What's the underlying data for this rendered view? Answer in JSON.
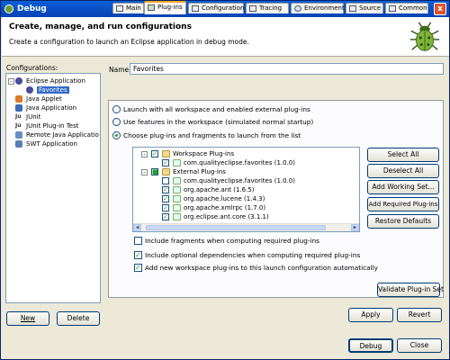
{
  "window": {
    "title": "Debug",
    "close_glyph": "x"
  },
  "header": {
    "title": "Create, manage, and run configurations",
    "subtitle": "Create a configuration to launch an Eclipse application in debug mode."
  },
  "configurations": {
    "label": "Configurations:",
    "items": [
      {
        "label": "Eclipse Application",
        "icon": "eclipse-icon",
        "expanded": true
      },
      {
        "label": "Favorites",
        "icon": "eclipse-config-icon",
        "selected": true
      },
      {
        "label": "Java Applet",
        "icon": "java-applet-icon"
      },
      {
        "label": "Java Application",
        "icon": "java-app-icon"
      },
      {
        "label": "JUnit",
        "icon": "junit-icon"
      },
      {
        "label": "JUnit Plug-in Test",
        "icon": "junit-plugin-icon"
      },
      {
        "label": "Remote Java Applicatio",
        "icon": "remote-java-icon"
      },
      {
        "label": "SWT Application",
        "icon": "swt-icon"
      }
    ],
    "new_label": "New",
    "delete_label": "Delete"
  },
  "name_label": "Name:",
  "name_value": "Favorites",
  "tabs": [
    {
      "label": "Main",
      "icon": "main-tab-icon"
    },
    {
      "label": "Plug-ins",
      "icon": "plugins-tab-icon",
      "active": true
    },
    {
      "label": "Configuration",
      "icon": "config-tab-icon"
    },
    {
      "label": "Tracing",
      "icon": "tracing-tab-icon"
    },
    {
      "label": "Environment",
      "icon": "environment-tab-icon"
    },
    {
      "label": "Source",
      "icon": "source-tab-icon"
    },
    {
      "label": "Common",
      "icon": "common-tab-icon"
    }
  ],
  "launch_options": [
    {
      "label": "Launch with all workspace and enabled external plug-ins",
      "selected": false
    },
    {
      "label": "Use features in the workspace (simulated normal startup)",
      "selected": false
    },
    {
      "label": "Choose plug-ins and fragments to launch from the list",
      "selected": true
    }
  ],
  "plugin_tree": [
    {
      "label": "Workspace Plug-ins",
      "level": 0,
      "checked": true,
      "expander": "-",
      "folder": true
    },
    {
      "label": "com.qualityeclipse.favorites (1.0.0)",
      "level": 1,
      "checked": true
    },
    {
      "label": "External Plug-ins",
      "level": 0,
      "checked": true,
      "partial": true,
      "expander": "-",
      "folder": true
    },
    {
      "label": "com.qualityeclipse.favorites (1.0.0)",
      "level": 1,
      "checked": false
    },
    {
      "label": "org.apache.ant (1.6.5)",
      "level": 1,
      "checked": true
    },
    {
      "label": "org.apache.lucene (1.4.3)",
      "level": 1,
      "checked": true
    },
    {
      "label": "org.apache.xmlrpc (1.7.0)",
      "level": 1,
      "checked": true
    },
    {
      "label": "org.eclipse.ant.core (3.1.1)",
      "level": 1,
      "checked": true
    }
  ],
  "plugin_buttons": {
    "select_all": "Select All",
    "deselect_all": "Deselect All",
    "add_working_set": "Add Working Set...",
    "add_required": "Add Required Plug-ins",
    "restore_defaults": "Restore Defaults"
  },
  "checkbox_options": [
    {
      "label": "Include fragments when computing required plug-ins",
      "checked": false
    },
    {
      "label": "Include optional dependencies when computing required plug-ins",
      "checked": true
    },
    {
      "label": "Add new workspace plug-ins to this launch configuration automatically",
      "checked": true
    }
  ],
  "validate_label": "Validate Plug-in Set",
  "apply_label": "Apply",
  "revert_label": "Revert",
  "debug_label": "Debug",
  "close_label": "Close",
  "colors": {
    "title_bar": "#0a5fd8",
    "selection": "#316ac5",
    "dialog_bg": "#ece9d8",
    "active_tab_accent": "#f5a623"
  }
}
